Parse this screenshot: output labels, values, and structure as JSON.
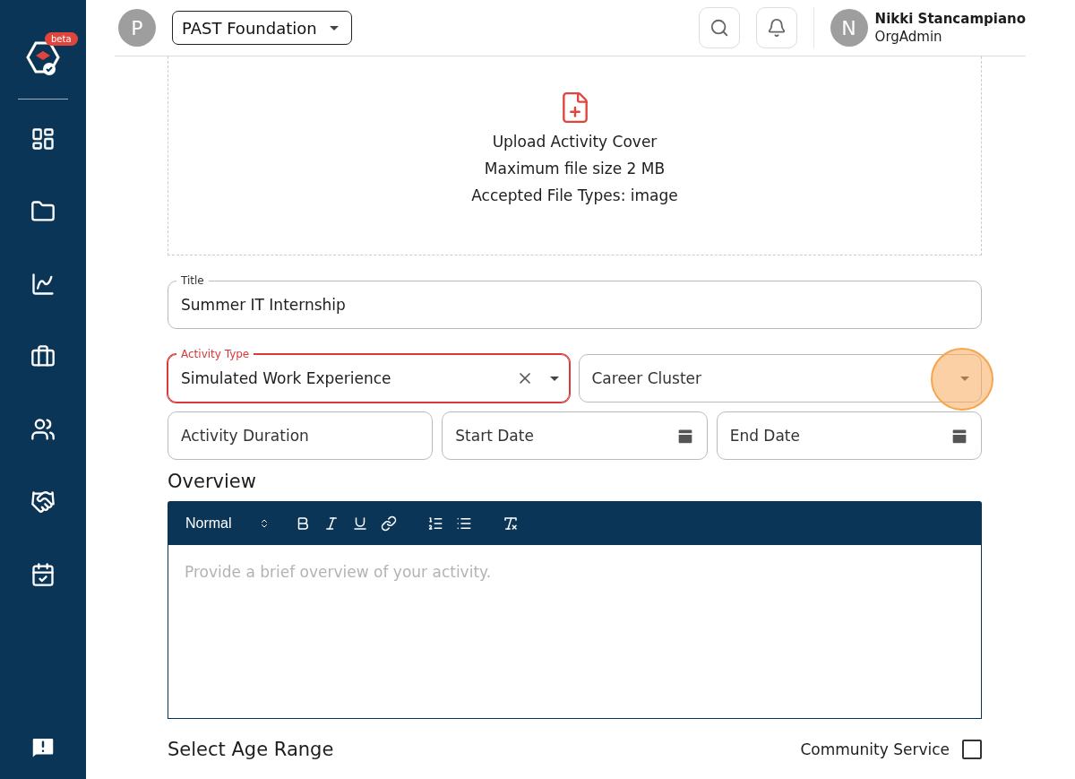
{
  "sidebar": {
    "badge": "beta"
  },
  "header": {
    "org_avatar": "P",
    "org_select": "PAST Foundation",
    "user_avatar": "N",
    "user_name": "Nikki Stancampiano",
    "user_role": "OrgAdmin"
  },
  "upload": {
    "title": "Upload Activity Cover",
    "max_size": "Maximum file size 2 MB",
    "types": "Accepted File Types: image"
  },
  "title_field": {
    "label": "Title",
    "value": "Summer IT Internship"
  },
  "activity_type": {
    "label": "Activity Type",
    "value": "Simulated Work Experience",
    "focused": true
  },
  "career_cluster": {
    "placeholder": "Career Cluster",
    "highlighted": true
  },
  "duration": {
    "placeholder": "Activity Duration"
  },
  "start_date": {
    "placeholder": "Start Date"
  },
  "end_date": {
    "placeholder": "End Date"
  },
  "overview": {
    "heading": "Overview",
    "format": "Normal",
    "placeholder": "Provide a brief overview of your activity."
  },
  "age_range": {
    "heading": "Select Age Range"
  },
  "community_service": {
    "label": "Community Service",
    "checked": false
  }
}
